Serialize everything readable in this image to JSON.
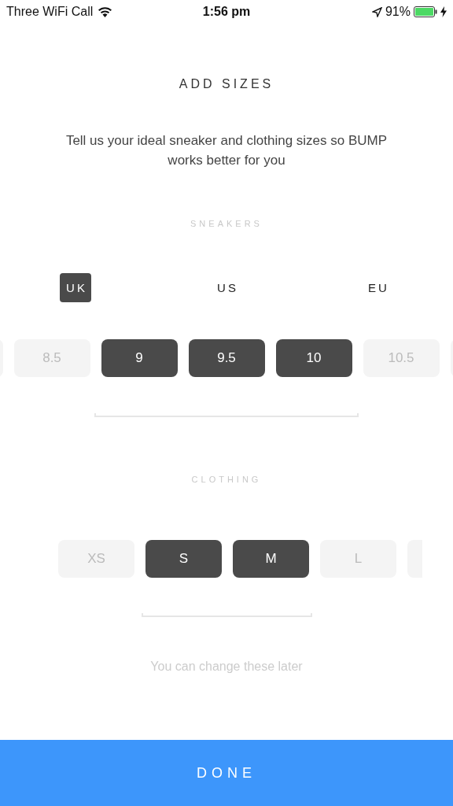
{
  "status_bar": {
    "carrier": "Three WiFi Call",
    "time": "1:56 pm",
    "battery": "91%"
  },
  "title": "ADD SIZES",
  "subtitle": "Tell us your ideal sneaker and clothing sizes so BUMP works better for you",
  "sneakers": {
    "heading": "SNEAKERS",
    "units": [
      {
        "label": "UK",
        "selected": true
      },
      {
        "label": "US",
        "selected": false
      },
      {
        "label": "EU",
        "selected": false
      }
    ],
    "sizes": [
      {
        "selected": false
      },
      {
        "label": "8.5",
        "selected": false
      },
      {
        "label": "9",
        "selected": true
      },
      {
        "label": "9.5",
        "selected": true
      },
      {
        "label": "10",
        "selected": true
      },
      {
        "label": "10.5",
        "selected": false
      },
      {
        "selected": false
      }
    ]
  },
  "clothing": {
    "heading": "CLOTHING",
    "sizes": [
      {
        "label": "XS",
        "selected": false
      },
      {
        "label": "S",
        "selected": true
      },
      {
        "label": "M",
        "selected": true
      },
      {
        "label": "L",
        "selected": false
      },
      {
        "selected": false
      }
    ]
  },
  "note": "You can change these later",
  "done_button": "DONE"
}
